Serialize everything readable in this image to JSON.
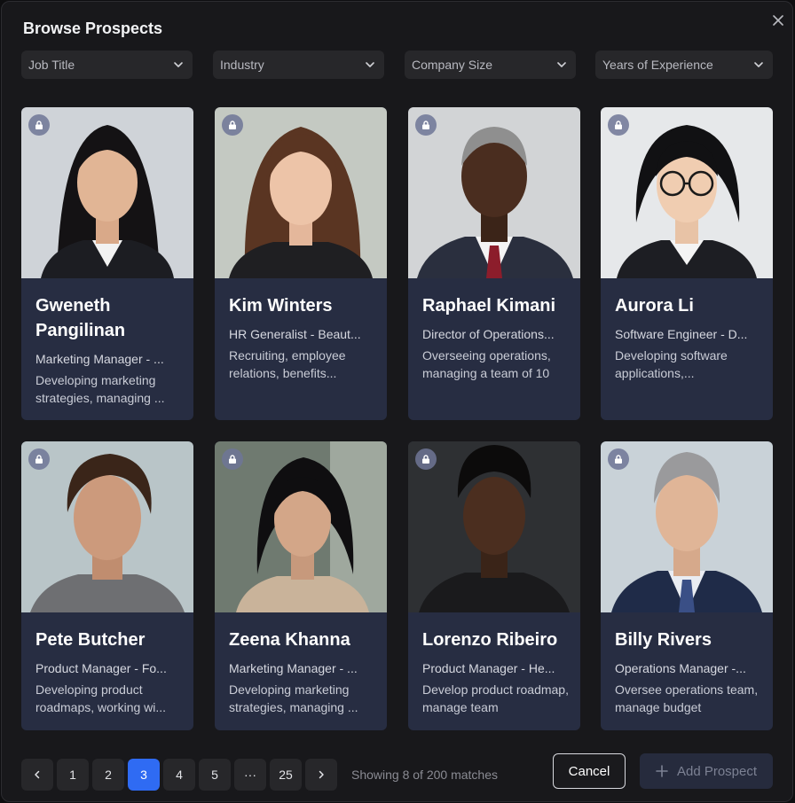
{
  "modal": {
    "title": "Browse Prospects"
  },
  "filters": [
    {
      "label": "Job Title"
    },
    {
      "label": "Industry"
    },
    {
      "label": "Company Size"
    },
    {
      "label": "Years of Experience"
    }
  ],
  "prospects": [
    {
      "name": "Gweneth Pangilinan",
      "title": "Marketing Manager - ...",
      "description": "Developing marketing strategies, managing ...",
      "locked": true
    },
    {
      "name": "Kim Winters",
      "title": "HR Generalist - Beaut...",
      "description": "Recruiting, employee relations, benefits...",
      "locked": true
    },
    {
      "name": "Raphael Kimani",
      "title": "Director of Operations...",
      "description": "Overseeing operations, managing a team of 10",
      "locked": true
    },
    {
      "name": "Aurora Li",
      "title": "Software Engineer - D...",
      "description": "Developing software applications,...",
      "locked": true
    },
    {
      "name": "Pete Butcher",
      "title": "Product Manager - Fo...",
      "description": "Developing product roadmaps, working wi...",
      "locked": true
    },
    {
      "name": "Zeena Khanna",
      "title": "Marketing Manager - ...",
      "description": "Developing marketing strategies, managing ...",
      "locked": true
    },
    {
      "name": "Lorenzo Ribeiro",
      "title": "Product Manager - He...",
      "description": "Develop product roadmap, manage team",
      "locked": true
    },
    {
      "name": "Billy Rivers",
      "title": "Operations Manager -...",
      "description": "Oversee operations team, manage budget",
      "locked": true
    }
  ],
  "pagination": {
    "pages": [
      "1",
      "2",
      "3",
      "4",
      "5",
      "···",
      "25"
    ],
    "current": "3",
    "showing_text": "Showing 8 of 200 matches"
  },
  "actions": {
    "cancel_label": "Cancel",
    "add_label": "Add Prospect"
  },
  "colors": {
    "accent": "#2f6bf3",
    "card_bg": "#272d42",
    "modal_bg": "#18181b"
  }
}
